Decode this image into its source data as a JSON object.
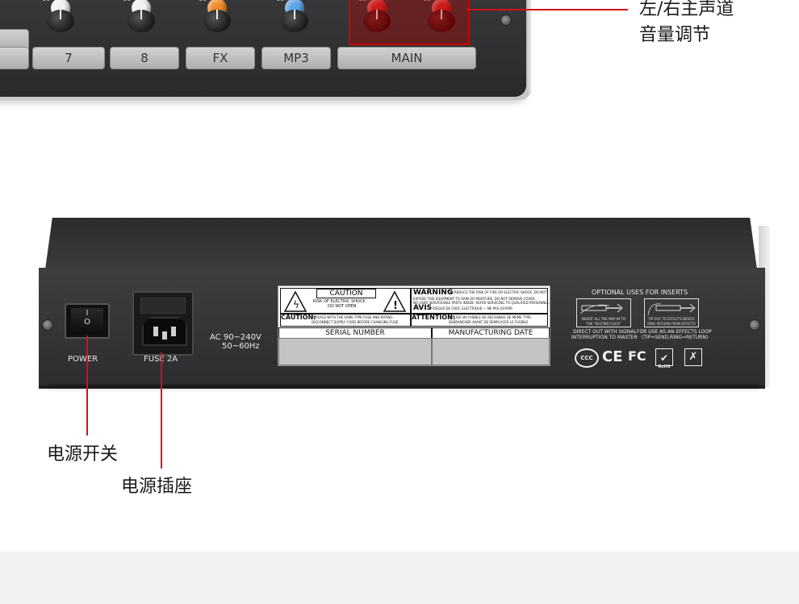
{
  "top_panel": {
    "channel_labels": [
      "7",
      "8",
      "FX",
      "MP3",
      "MAIN"
    ],
    "knob_scale": "60",
    "knob_scale_sub": "∞",
    "knob_colors": {
      "ch7": "#f2f2f2",
      "ch8": "#f2f2f2",
      "fx": "#f08a2a",
      "mp3": "#5ba4e6",
      "main": "#d82a2a"
    }
  },
  "callouts": {
    "main_volume": [
      "左/右主声道",
      "音量调节"
    ],
    "power_switch": "电源开关",
    "power_socket": "电源插座"
  },
  "rear_panel": {
    "power_label": "POWER",
    "power_on": "I",
    "power_off": "O",
    "fuse_label": "FUSE 2A",
    "ac_line1": "AC 90~240V",
    "ac_line2": "50~60Hz",
    "caution_title": "CAUTION",
    "caution_l1": "RISK OF ELECTRIC SHOCK",
    "caution_l2": "DO NOT OPEN",
    "warning_title": "WARNING",
    "warning_text": "TO REDUCE THE RISK OF FIRE OR ELECTRIC SHOCK, DO NOT",
    "warning_text2": "EXPOSE THIS EQUIPMENT TO RAIN OR MOISTURE. DO NOT REMOVE COVER.",
    "warning_text3": "NO USER SERVICEABLE PARTS INSIDE. REFER SERVICING TO QUALIFIED PERSONNEL.",
    "avis_title": "AVIS",
    "avis_text": "RISQUE DE CHOC ELECTRIQUE — NE PAS OUVRIR",
    "caution2_title": "CAUTION:",
    "caution2_text": "REPLACE WITH THE SAME TYPE FUSE AND RATING.",
    "caution2_text2": "DISCONNECT SUPPLY CORD BEFORE CHANGING FUSE",
    "attention_title": "ATTENTION:",
    "attention_text": "UTILISE UN FUSIBLE DE RECHANGE DE MEME TYPE.",
    "attention_text2": "DEBRANCHER AVANT DE REMPLACER LE FUSIBLE",
    "serial_label": "SERIAL NUMBER",
    "mfg_label": "MANUFACTURING DATE",
    "inserts_title": "OPTIONAL USES FOR INSERTS",
    "insert1_box": "INSERT ALL THE WAY IN TO THE \"SECOND CLICK\"",
    "insert2_box": "TIP OUT TO EFFECTS DEVICE RING RETURN FROM EFFECTS",
    "insert1_l1": "DIRECT OUT WITH SIGNAL",
    "insert1_l2": "INTERRUPTION TO MASTER",
    "insert2_l1": "FOR USE AS AN EFFECTS LOOP",
    "insert2_l2": "(TIP=SEND,RING=RETURN)",
    "cert_ce": "CE",
    "cert_fc": "FC",
    "cert_ccc": "CCC",
    "cert_rohs": "RoHS"
  }
}
